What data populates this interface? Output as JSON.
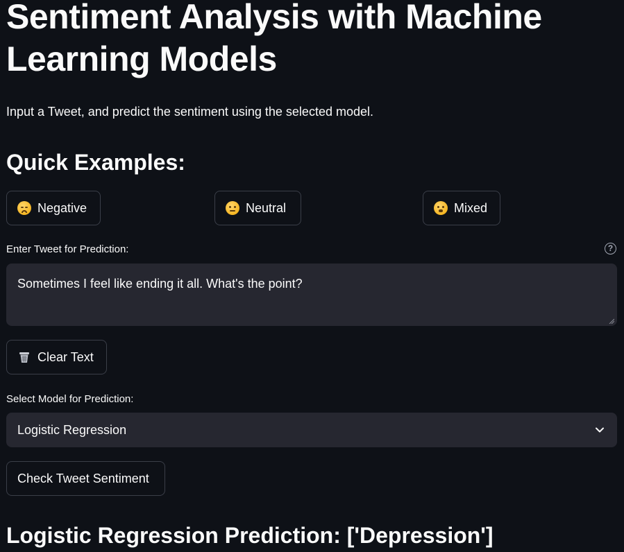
{
  "header": {
    "title": "Sentiment Analysis with Machine Learning Models",
    "subtitle": "Input a Tweet, and predict the sentiment using the selected model."
  },
  "quick_examples": {
    "heading": "Quick Examples:",
    "buttons": [
      {
        "label": "Negative",
        "icon": "disappointed-face-icon"
      },
      {
        "label": "Neutral",
        "icon": "neutral-face-icon"
      },
      {
        "label": "Mixed",
        "icon": "confused-face-icon"
      }
    ]
  },
  "tweet_input": {
    "label": "Enter Tweet for Prediction:",
    "help_icon": "?",
    "value": "Sometimes I feel like ending it all. What's the point?"
  },
  "clear_button": {
    "label": "Clear Text",
    "icon": "wastebasket-icon"
  },
  "model_select": {
    "label": "Select Model for Prediction:",
    "selected": "Logistic Regression"
  },
  "check_button": {
    "label": "Check Tweet Sentiment"
  },
  "result": {
    "text": "Logistic Regression Prediction: ['Depression']"
  },
  "colors": {
    "background": "#0e1117",
    "input_background": "#262730",
    "border": "#3b3f49",
    "text": "#fafafa"
  }
}
